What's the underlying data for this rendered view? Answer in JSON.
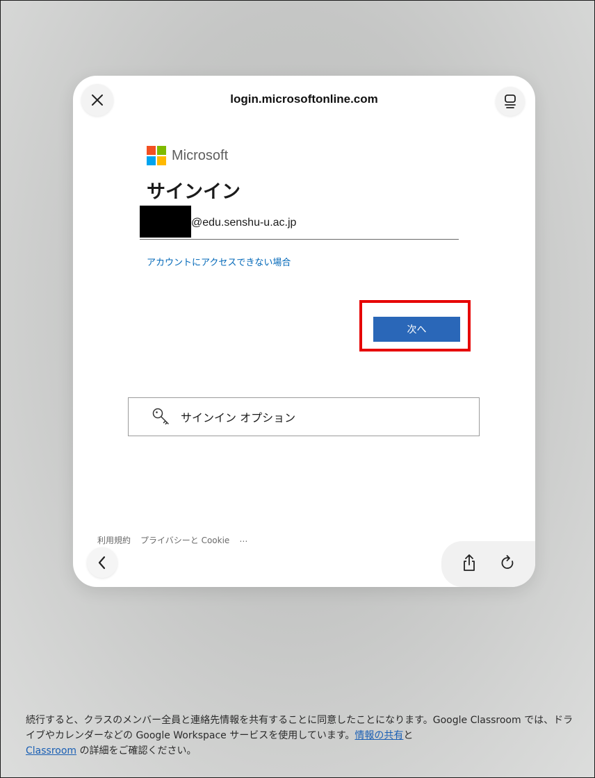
{
  "browser": {
    "url": "login.microsoftonline.com"
  },
  "login": {
    "brand": "Microsoft",
    "title": "サインイン",
    "email_suffix": "@edu.senshu-u.ac.jp",
    "cant_access": "アカウントにアクセスできない場合",
    "next_button": "次へ",
    "signin_options": "サインイン オプション"
  },
  "footer_links": {
    "terms": "利用規約",
    "privacy": "プライバシーと Cookie",
    "more": "…"
  },
  "consent": {
    "text_1": "続行すると、クラスのメンバー全員と連絡先情報を共有することに同意したことになります。Google Classroom では、ドライブやカレンダーなどの Google Workspace サービスを使用しています。",
    "link_1": "情報の共有",
    "text_2": "と",
    "link_2": "Classroom",
    "text_3": " の詳細をご確認ください。"
  },
  "colors": {
    "ms_red": "#f25022",
    "ms_green": "#7fba00",
    "ms_blue": "#00a4ef",
    "ms_yellow": "#ffb900",
    "primary_button": "#2a67b8",
    "highlight_border": "#e60000",
    "link": "#0067b8"
  },
  "icons": {
    "close": "close-icon",
    "tabs": "tab-overview-icon",
    "key": "key-icon",
    "back": "chevron-left-icon",
    "share": "share-icon",
    "reload": "reload-icon"
  }
}
